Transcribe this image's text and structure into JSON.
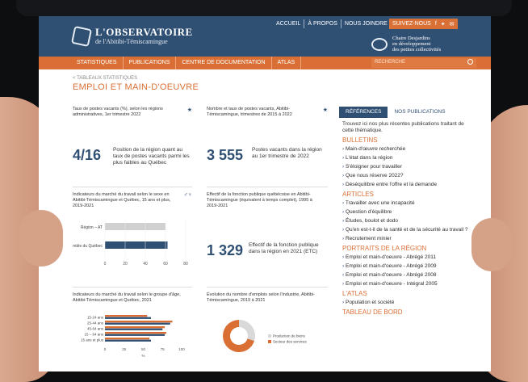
{
  "header": {
    "brand_line1": "L'OBSERVATOIRE",
    "brand_line2": "de l'Abitibi-Témiscamingue",
    "topnav": [
      "ACCUEIL",
      "À PROPOS",
      "NOUS JOINDRE"
    ],
    "follow_label": "SUIVEZ-NOUS",
    "chaire_lines": [
      "Chaire Desjardins",
      "en développement",
      "des petites collectivités"
    ]
  },
  "menu": {
    "items": [
      "STATISTIQUES",
      "PUBLICATIONS",
      "CENTRE DE DOCUMENTATION",
      "ATLAS"
    ],
    "search_placeholder": "RECHERCHE"
  },
  "page": {
    "breadcrumb": "< TABLEAUX STATISTIQUES",
    "title": "EMPLOI ET MAIN-D'OEUVRE"
  },
  "cards": {
    "c1_title": "Taux de postes vacants (%), selon les régions administratives, 1er trimestre 2022",
    "c1_num": "4/16",
    "c1_text": "Position de la région quant au taux de postes vacants parmi les plus faibles au Québec",
    "c2_title": "Nombre et taux de postes vacants, Abitibi-Témiscamingue, trimestres de 2015 à 2022",
    "c2_num": "3 555",
    "c2_text": "Postes vacants dans la région au 1er trimestre de 2022",
    "c3_title": "Indicateurs du marché du travail selon le sexe en Abitibi-Témiscamingue et Québec, 15 ans et plus, 2019-2021",
    "c4_title": "Effectif de la fonction publique québécoise en Abitibi-Témiscamingue (équivalent à temps complet), 1995 à 2019-2021",
    "c4_num": "1 329",
    "c4_text": "Effectif de la fonction publique dans la région en 2021 (ETC)",
    "c5_title": "Indicateurs du marché du travail selon le groupe d'âge, Abitibi-Témiscamingue et Québec, 2021",
    "c6_title": "Évolution du nombre d'emplois selon l'industrie, Abitibi-Témiscamingue, 2019 à 2021"
  },
  "sidebar": {
    "tab_active": "RÉFÉRENCES",
    "tab_inactive": "NOS PUBLICATIONS",
    "intro": "Trouvez ici nos plus récentes publications traitant de cette thématique.",
    "bulletins_title": "BULLETINS",
    "bulletins": [
      "Main-d'œuvre recherchée",
      "L'état dans la région",
      "S'éloigner pour travailler",
      "Que nous réserve 2022?",
      "Déséquilibre entre l'offre et la demande"
    ],
    "articles_title": "ARTICLES",
    "articles": [
      "Travailler avec une incapacité",
      "Question d'équilibre",
      "Études, boulot et dodo",
      "Qu'en est-t-il de la santé et de la sécurité au travail ?",
      "Recrutement minier"
    ],
    "portraits_title": "PORTRAITS DE LA RÉGION",
    "portraits": [
      "Emploi et main-d'oeuvre - Abrégé 2011",
      "Emploi et main-d'oeuvre - Abrégé 2009",
      "Emploi et main-d'oeuvre - Abrégé 2008",
      "Emploi et main-d'oeuvre - Intégral 2005"
    ],
    "atlas_title": "L'ATLAS",
    "atlas": [
      "Population et société"
    ],
    "dashboard_title": "TABLEAU DE BORD"
  },
  "chart_data": [
    {
      "type": "bar",
      "orientation": "horizontal",
      "categories": [
        "Région – AT",
        "Ensemble du Québec"
      ],
      "series": [
        {
          "values": [
            60,
            62
          ]
        }
      ],
      "xlim": [
        0,
        80
      ],
      "xticks": [
        0,
        20,
        40,
        60,
        80
      ]
    },
    {
      "type": "bar",
      "orientation": "horizontal",
      "categories": [
        "15-24 ans",
        "25-44 ans",
        "45-64 ans",
        "15 – 64 ans",
        "15 ans et plus"
      ],
      "series": [
        {
          "values": [
            55,
            88,
            78,
            80,
            58
          ]
        },
        {
          "values": [
            60,
            85,
            75,
            78,
            60
          ]
        }
      ],
      "xlim": [
        0,
        100
      ],
      "xticks": [
        0,
        25,
        50,
        75,
        100
      ],
      "xlabel": "%"
    },
    {
      "type": "pie",
      "slices": [
        {
          "label": "Production de biens",
          "value": 30,
          "color": "#d9d9d9"
        },
        {
          "label": "Secteur des services",
          "value": 70,
          "color": "#d96f35"
        }
      ]
    }
  ],
  "colors": {
    "primary": "#2f4f73",
    "accent": "#d96f35"
  }
}
